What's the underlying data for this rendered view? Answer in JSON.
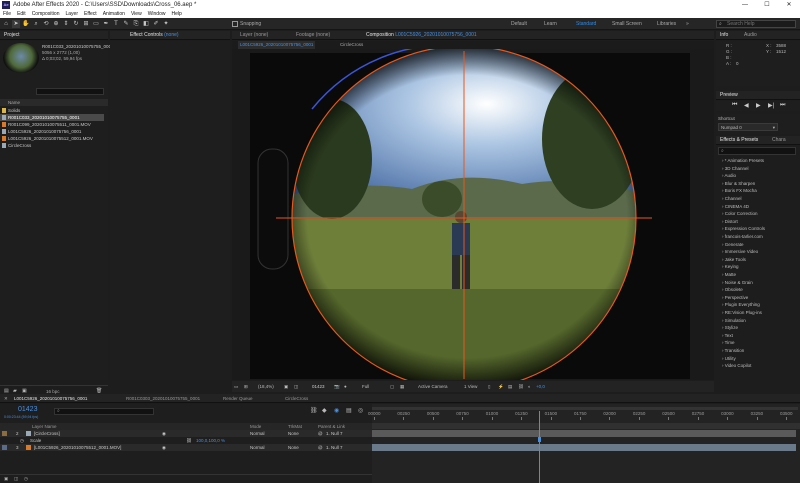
{
  "window": {
    "app_badge": "Ae",
    "title": "Adobe After Effects 2020 - C:\\Users\\SSD\\Downloads\\Cross_06.aep *",
    "minimize": "—",
    "maximize": "☐",
    "close": "✕"
  },
  "menu": [
    "File",
    "Edit",
    "Composition",
    "Layer",
    "Effect",
    "Animation",
    "View",
    "Window",
    "Help"
  ],
  "toolbar": {
    "snapping_label": "Snapping",
    "workspaces": [
      "Default",
      "Learn",
      "Standard",
      "Small Screen",
      "Libraries"
    ],
    "active_workspace": "Standard",
    "search_placeholder": "Search Help"
  },
  "project": {
    "tab": "Project",
    "selected_name": "R001C033_20201010075755_0001",
    "selected_info1": "5056 x 2772 (1,00)",
    "selected_info2": "Δ 0;03;02, 59,94 fps",
    "column_name": "Name",
    "bpc": "16 bpc",
    "items": [
      {
        "name": "Solids",
        "icon_color": "#d9b54a"
      },
      {
        "name": "R001C033_20201010075755_0001",
        "icon_color": "#9aa9b8"
      },
      {
        "name": "R001C099_20201010075511_0001.MOV",
        "icon_color": "#d97a2b"
      },
      {
        "name": "L001C5926_20201010075756_0001",
        "icon_color": "#9aa9b8"
      },
      {
        "name": "L001C5926_20201010075512_0001.MOV",
        "icon_color": "#d97a2b"
      },
      {
        "name": "CircleCross",
        "icon_color": "#9aa9b8"
      }
    ]
  },
  "effect_controls": {
    "tab": "Effect Controls",
    "target": "(none)"
  },
  "viewer": {
    "tabs": {
      "layer": "Layer (none)",
      "footage": "Footage (none)",
      "composition_prefix": "Composition",
      "composition_name": "L001C5926_20201010075756_0001"
    },
    "breadcrumb_active": "L001C5926_20201010075756_0001",
    "breadcrumb_next": "CircleCross",
    "footer": {
      "zoom": "(18,4%)",
      "timecode": "01423",
      "resolution": "Full",
      "camera": "Active Camera",
      "views": "1 View",
      "exposure": "+0,0"
    }
  },
  "info": {
    "tab_info": "Info",
    "tab_audio": "Audio",
    "r_label": "R :",
    "g_label": "G :",
    "b_label": "B :",
    "a_label": "A :",
    "a_value": "0",
    "x_label": "X :",
    "x_value": "3588",
    "y_label": "Y :",
    "y_value": "1512"
  },
  "preview": {
    "tab": "Preview",
    "controls": [
      "⏮",
      "◀",
      "▶",
      "▶|",
      "⏭"
    ]
  },
  "shortcut": {
    "label": "Shortcut",
    "value": "Numpad 0"
  },
  "effects_presets": {
    "tab": "Effects & Presets",
    "tab_char": "Chara",
    "search_placeholder": "",
    "categories": [
      "* Animation Presets",
      "3D Channel",
      "Audio",
      "Blur & Sharpen",
      "Boris FX Mocha",
      "Channel",
      "CINEMA 4D",
      "Color Correction",
      "Distort",
      "Expression Controls",
      "francois-tarlier.com",
      "Generate",
      "Immersive Video",
      "Jake Tools",
      "Keying",
      "Matte",
      "Noise & Grain",
      "Obsolete",
      "Perspective",
      "Plugin Everything",
      "RE:Vision Plug-ins",
      "Simulation",
      "Stylize",
      "Text",
      "Time",
      "Transition",
      "Utility",
      "Video Copilot"
    ]
  },
  "timeline": {
    "tabs": [
      {
        "label": "L001C5926_20201010075756_0001",
        "active": true
      },
      {
        "label": "R001C0303_20201010075755_0001",
        "active": false
      },
      {
        "label": "Render Queue",
        "active": false
      },
      {
        "label": "CircleCross",
        "active": false
      }
    ],
    "timecode": "01423",
    "timecode_sub": "0:00:23:44 (59,94 fps)",
    "search_placeholder": "",
    "columns": {
      "layer_name": "Layer Name",
      "mode": "Mode",
      "trkmat": "TrkMat",
      "parent": "Parent & Link"
    },
    "layers": [
      {
        "index": "2",
        "name": "[CircleCross]",
        "mode": "Normal",
        "trkmat": "None",
        "parent": "1. Null 7",
        "label_color": "#8c6d3f"
      },
      {
        "index": "",
        "name": "Scale",
        "mode": "",
        "trkmat": "",
        "parent": "",
        "value": "100,0,100,0 %",
        "label_color": ""
      },
      {
        "index": "3",
        "name": "[L001C5926_20201010075512_0001.MOV]",
        "mode": "Normal",
        "trkmat": "None",
        "parent": "1. Null 7",
        "label_color": "#5a6b8c"
      }
    ],
    "ruler": [
      "00000",
      "00250",
      "00500",
      "00750",
      "01000",
      "01250",
      "01500",
      "01750",
      "02000",
      "02250",
      "02500",
      "02750",
      "03000",
      "03250",
      "03500"
    ],
    "playhead_fraction": 0.4,
    "toggle_label": "Toggle Switches / Modes"
  },
  "colors": {
    "accent": "#2d8ceb",
    "crosshair": "#e8581c",
    "ui_bg": "#1d1d1d"
  }
}
